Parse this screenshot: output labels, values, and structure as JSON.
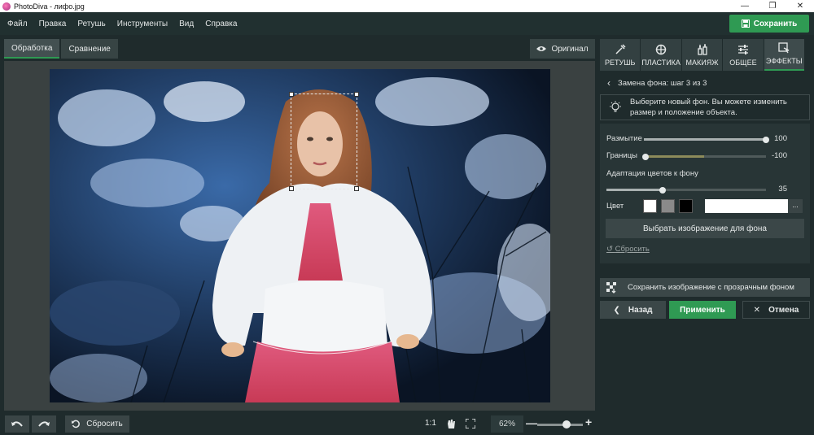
{
  "window": {
    "title": "PhotoDiva - лифо.jpg",
    "controls": [
      "minimize",
      "maximize",
      "close"
    ]
  },
  "menu": {
    "items": [
      "Файл",
      "Правка",
      "Ретушь",
      "Инструменты",
      "Вид",
      "Справка"
    ]
  },
  "toolbar": {
    "save_label": "Сохранить"
  },
  "view_tabs": {
    "processing": "Обработка",
    "compare": "Сравнение",
    "original": "Оригинал"
  },
  "tool_tabs": [
    {
      "label": "РЕТУШЬ",
      "icon": "retouch-icon"
    },
    {
      "label": "ПЛАСТИКА",
      "icon": "plastic-icon"
    },
    {
      "label": "МАКИЯЖ",
      "icon": "makeup-icon"
    },
    {
      "label": "ОБЩЕЕ",
      "icon": "sliders-icon"
    },
    {
      "label": "ЭФФЕКТЫ",
      "icon": "effects-icon",
      "active": true
    }
  ],
  "panel": {
    "step_title": "Замена фона: шаг 3 из 3",
    "hint_line1": "Выберите новый фон. Вы можете изменить",
    "hint_line2": "размер и положение объекта.",
    "blur": {
      "label": "Размытие",
      "value": 100,
      "position": 1.0
    },
    "edges": {
      "label": "Границы",
      "value": -100,
      "position": 0.0
    },
    "color_adapt": {
      "label": "Адаптация цветов к фону",
      "value": 35,
      "position": 0.35
    },
    "color_label": "Цвет",
    "swatches": [
      "#ffffff",
      "#8a8a8a",
      "#000000"
    ],
    "more": "...",
    "choose_bg": "Выбрать изображение для фона",
    "reset": "Сбросить",
    "save_transparent": "Сохранить изображение с прозрачным фоном",
    "back": "Назад",
    "apply": "Применить",
    "cancel": "Отмена"
  },
  "bottom": {
    "reset": "Сбросить",
    "actual_size": "1:1",
    "zoom": "62%",
    "zoom_position": 0.62
  },
  "colors": {
    "accent": "#2f9a53",
    "background": "#1f2b2c",
    "panel": "#283536"
  }
}
